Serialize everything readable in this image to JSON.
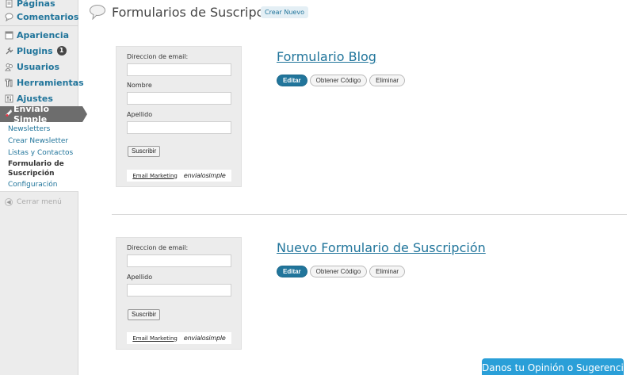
{
  "sidebar": {
    "items": [
      {
        "label": "Páginas",
        "icon": "pages-icon"
      },
      {
        "label": "Comentarios",
        "icon": "comments-icon"
      },
      {
        "label": "Apariencia",
        "icon": "appearance-icon"
      },
      {
        "label": "Plugins",
        "icon": "plugins-icon",
        "badge": "1"
      },
      {
        "label": "Usuarios",
        "icon": "users-icon"
      },
      {
        "label": "Herramientas",
        "icon": "tools-icon"
      },
      {
        "label": "Ajustes",
        "icon": "settings-icon"
      }
    ],
    "active": {
      "label": "Envialo Simple",
      "icon": "envialo-icon"
    },
    "submenu": [
      {
        "label": "Newsletters"
      },
      {
        "label": "Crear Newsletter"
      },
      {
        "label": "Listas y Contactos"
      },
      {
        "label": "Formulario de Suscripción",
        "current": true
      },
      {
        "label": "Configuración"
      }
    ],
    "collapse_label": "Cerrar menú"
  },
  "header": {
    "title": "Formularios de Suscripción",
    "add_new_label": "Crear Nuevo"
  },
  "forms": [
    {
      "title": "Formulario Blog",
      "fields": [
        "Direccion de email:",
        "Nombre",
        "Apellido"
      ],
      "submit_label": "Suscribir",
      "footer_link": "Email Marketing",
      "brand": "envialosimple",
      "actions": [
        "Editar",
        "Obtener Código",
        "Eliminar"
      ]
    },
    {
      "title": "Nuevo Formulario de Suscripción",
      "fields": [
        "Direccion de email:",
        "Apellido"
      ],
      "submit_label": "Suscribir",
      "footer_link": "Email Marketing",
      "brand": "envialosimple",
      "actions": [
        "Editar",
        "Obtener Código",
        "Eliminar"
      ]
    }
  ],
  "feedback_label": "Danos tu Opinión o Sugerencia",
  "colors": {
    "link": "#21759b",
    "primary_button": "#21759b",
    "feedback": "#2a9fd8",
    "active_menu": "#6d6d6d"
  }
}
